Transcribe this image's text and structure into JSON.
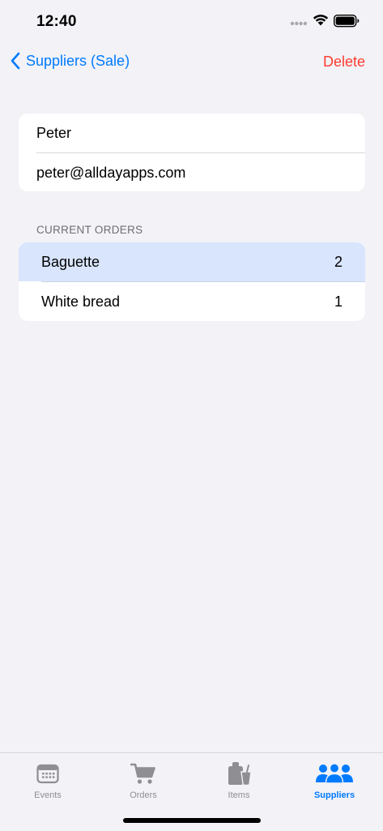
{
  "status_bar": {
    "time": "12:40"
  },
  "nav": {
    "back_label": "Suppliers (Sale)",
    "delete_label": "Delete"
  },
  "supplier": {
    "name": "Peter",
    "email": "peter@alldayapps.com"
  },
  "orders_section": {
    "header": "CURRENT ORDERS",
    "rows": [
      {
        "item": "Baguette",
        "qty": "2",
        "selected": true
      },
      {
        "item": "White bread",
        "qty": "1",
        "selected": false
      }
    ]
  },
  "tab_bar": {
    "tabs": [
      {
        "label": "Events",
        "icon": "calendar-icon",
        "active": false
      },
      {
        "label": "Orders",
        "icon": "cart-icon",
        "active": false
      },
      {
        "label": "Items",
        "icon": "bag-cup-icon",
        "active": false
      },
      {
        "label": "Suppliers",
        "icon": "people-icon",
        "active": true
      }
    ]
  },
  "colors": {
    "accent": "#007aff",
    "destructive": "#ff3b30",
    "selected_row": "#d9e5fc",
    "background": "#f2f2f7",
    "inactive_tab": "#8e8e93"
  }
}
